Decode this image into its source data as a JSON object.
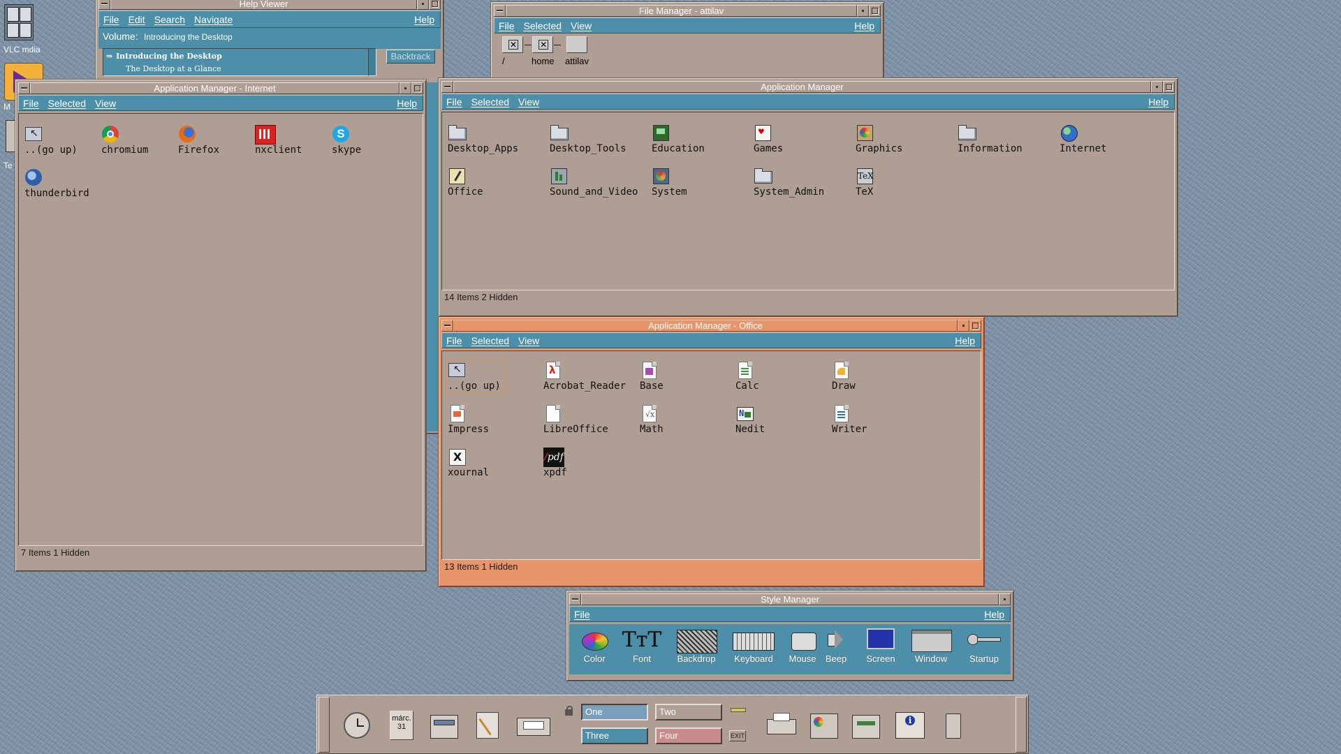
{
  "desktop_icons": [
    {
      "label": "VLC mdia",
      "icon": "vlc-media-icon"
    },
    {
      "label": "M",
      "icon": "media-icon"
    },
    {
      "label": "Te",
      "icon": "terminal-icon"
    }
  ],
  "help_viewer": {
    "title": "Help Viewer",
    "menu": [
      "File",
      "Edit",
      "Search",
      "Navigate"
    ],
    "help": "Help",
    "volume_label": "Volume:",
    "volume_value": "Introducing the Desktop",
    "topics": [
      "Introducing the Desktop",
      "The Desktop at a Glance"
    ],
    "backtrack": "Backtrack"
  },
  "file_manager": {
    "title": "File Manager - attilav",
    "menu": [
      "File",
      "Selected",
      "View"
    ],
    "help": "Help",
    "path": [
      "/",
      "home",
      "attilav"
    ]
  },
  "app_manager_internet": {
    "title": "Application Manager - Internet",
    "menu": [
      "File",
      "Selected",
      "View"
    ],
    "help": "Help",
    "items": [
      {
        "label": "..(go up)",
        "icon": "go-up-icon"
      },
      {
        "label": "chromium",
        "icon": "chromium-icon"
      },
      {
        "label": "Firefox",
        "icon": "firefox-icon"
      },
      {
        "label": "nxclient",
        "icon": "nxclient-icon"
      },
      {
        "label": "skype",
        "icon": "skype-icon"
      },
      {
        "label": "thunderbird",
        "icon": "thunderbird-icon"
      }
    ],
    "status": "7 Items 1 Hidden"
  },
  "app_manager": {
    "title": "Application Manager",
    "menu": [
      "File",
      "Selected",
      "View"
    ],
    "help": "Help",
    "items": [
      {
        "label": "Desktop_Apps",
        "icon": "folder-icon"
      },
      {
        "label": "Desktop_Tools",
        "icon": "folder-icon"
      },
      {
        "label": "Education",
        "icon": "education-icon"
      },
      {
        "label": "Games",
        "icon": "games-icon"
      },
      {
        "label": "Graphics",
        "icon": "graphics-icon"
      },
      {
        "label": "Information",
        "icon": "folder-icon"
      },
      {
        "label": "Internet",
        "icon": "internet-icon"
      },
      {
        "label": "Office",
        "icon": "office-icon"
      },
      {
        "label": "Sound_and_Video",
        "icon": "sound-video-icon"
      },
      {
        "label": "System",
        "icon": "system-icon"
      },
      {
        "label": "System_Admin",
        "icon": "folder-icon"
      },
      {
        "label": "TeX",
        "icon": "tex-icon"
      }
    ],
    "status": "14 Items 2 Hidden"
  },
  "app_manager_office": {
    "title": "Application Manager - Office",
    "menu": [
      "File",
      "Selected",
      "View"
    ],
    "help": "Help",
    "items": [
      {
        "label": "..(go up)",
        "icon": "go-up-icon"
      },
      {
        "label": "Acrobat_Reader",
        "icon": "acrobat-icon"
      },
      {
        "label": "Base",
        "icon": "libreoffice-base-icon"
      },
      {
        "label": "Calc",
        "icon": "libreoffice-calc-icon"
      },
      {
        "label": "Draw",
        "icon": "libreoffice-draw-icon"
      },
      {
        "label": "Impress",
        "icon": "libreoffice-impress-icon"
      },
      {
        "label": "LibreOffice",
        "icon": "libreoffice-icon"
      },
      {
        "label": "Math",
        "icon": "libreoffice-math-icon"
      },
      {
        "label": "Nedit",
        "icon": "nedit-icon"
      },
      {
        "label": "Writer",
        "icon": "libreoffice-writer-icon"
      },
      {
        "label": "xournal",
        "icon": "xournal-icon"
      },
      {
        "label": "xpdf",
        "icon": "xpdf-icon"
      }
    ],
    "status": "13 Items 1 Hidden"
  },
  "style_manager": {
    "title": "Style Manager",
    "menu": [
      "File"
    ],
    "help": "Help",
    "items": [
      "Color",
      "Font",
      "Backdrop",
      "Keyboard",
      "Mouse",
      "Beep",
      "Screen",
      "Window",
      "Startup"
    ]
  },
  "front_panel": {
    "calendar_month": "márc.",
    "calendar_day": "31",
    "workspaces": [
      "One",
      "Two",
      "Three",
      "Four"
    ],
    "exit_label": "EXIT"
  },
  "colors": {
    "desktop": "#7f93a8",
    "frame_inactive": "#ae9e94",
    "frame_active": "#e8956b",
    "menubar": "#4d8ea8"
  }
}
